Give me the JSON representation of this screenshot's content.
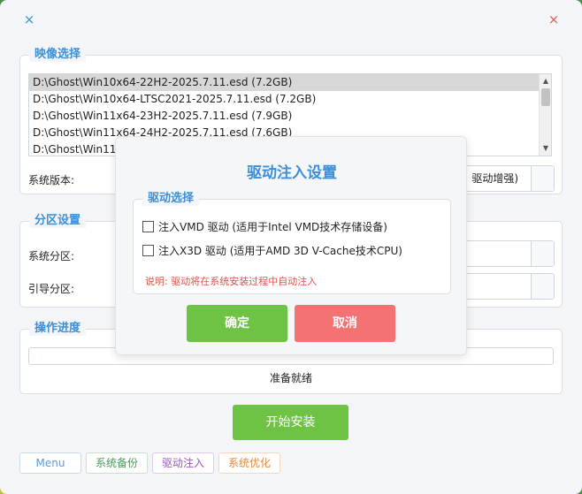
{
  "titlebar": {
    "left_icon": "×",
    "right_icon": "×"
  },
  "image_group": {
    "title": "映像选择",
    "items": [
      "D:\\Ghost\\Win10x64-22H2-2025.7.11.esd (7.2GB)",
      "D:\\Ghost\\Win10x64-LTSC2021-2025.7.11.esd (7.2GB)",
      "D:\\Ghost\\Win11x64-23H2-2025.7.11.esd (7.9GB)",
      "D:\\Ghost\\Win11x64-24H2-2025.7.11.esd (7.6GB)",
      "D:\\Ghost\\Win11"
    ],
    "version_label": "系统版本:",
    "version_value": "驱动增强)"
  },
  "partition_group": {
    "title": "分区设置",
    "system_label": "系统分区:",
    "boot_label": "引导分区:"
  },
  "progress_group": {
    "title": "操作进度",
    "progress": 0,
    "status": "准备就绪"
  },
  "start_button": "开始安装",
  "tags": [
    {
      "label": "Menu",
      "color": "#5b9bd5"
    },
    {
      "label": "系统备份",
      "color": "#4a9a5a"
    },
    {
      "label": "驱动注入",
      "color": "#9b59b6"
    },
    {
      "label": "系统优化",
      "color": "#e08a3c"
    }
  ],
  "dialog": {
    "title": "驱动注入设置",
    "group_title": "驱动选择",
    "option_vmd": "注入VMD 驱动 (适用于Intel VMD技术存储设备)",
    "option_x3d": "注入X3D 驱动 (适用于AMD 3D V-Cache技术CPU)",
    "option_vmd_checked": false,
    "option_x3d_checked": false,
    "note": "说明: 驱动将在系统安装过程中自动注入",
    "ok": "确定",
    "cancel": "取消"
  }
}
